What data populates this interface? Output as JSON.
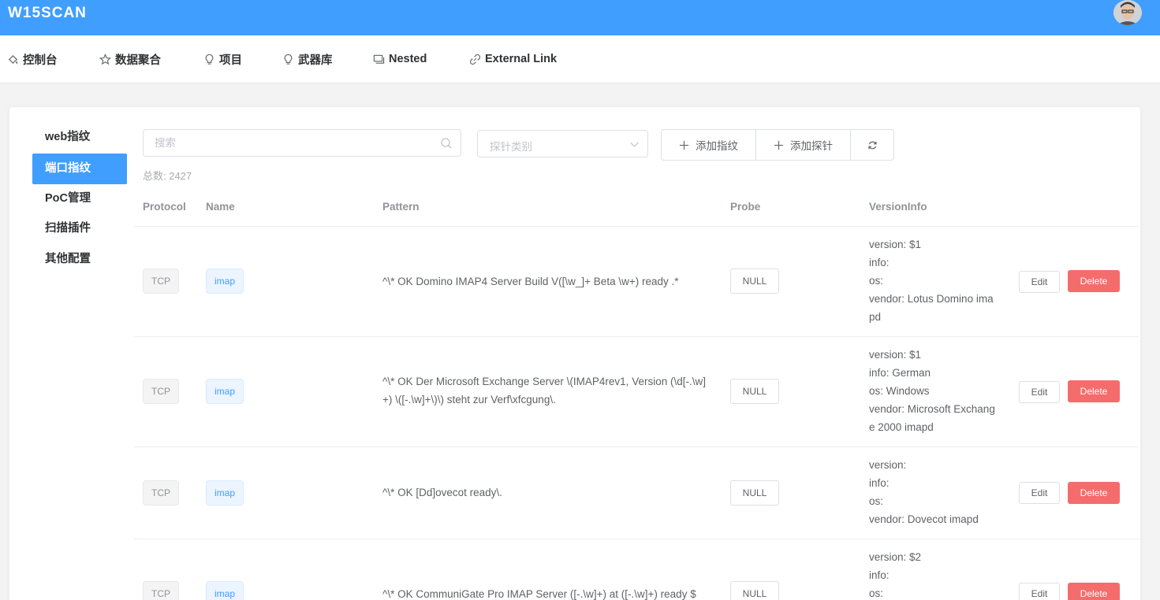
{
  "app": {
    "title": "W15SCAN"
  },
  "nav": [
    {
      "label": "控制台",
      "icon": "paint-bucket-icon"
    },
    {
      "label": "数据聚合",
      "icon": "star-icon"
    },
    {
      "label": "项目",
      "icon": "lightbulb-icon"
    },
    {
      "label": "武器库",
      "icon": "lightbulb-icon"
    },
    {
      "label": "Nested",
      "icon": "window-icon"
    },
    {
      "label": "External Link",
      "icon": "link-icon"
    }
  ],
  "sidebar": {
    "items": [
      {
        "label": "web指纹",
        "active": false
      },
      {
        "label": "端口指纹",
        "active": true
      },
      {
        "label": "PoC管理",
        "active": false
      },
      {
        "label": "扫描插件",
        "active": false
      },
      {
        "label": "其他配置",
        "active": false
      }
    ]
  },
  "toolbar": {
    "search_placeholder": "搜索",
    "probe_select_placeholder": "探针类别",
    "add_fingerprint_label": "添加指纹",
    "add_probe_label": "添加探针"
  },
  "total_label": "总数: 2427",
  "table": {
    "headers": {
      "protocol": "Protocol",
      "name": "Name",
      "pattern": "Pattern",
      "probe": "Probe",
      "versioninfo": "VersionInfo"
    },
    "rows": [
      {
        "protocol": "TCP",
        "name": "imap",
        "pattern": "^\\* OK Domino IMAP4 Server Build V([\\w_]+ Beta \\w+) ready .*",
        "probe": "NULL",
        "version": "version: $1",
        "info": "info:",
        "os": "os:",
        "vendor": "vendor: Lotus Domino imapd",
        "edit": "Edit",
        "delete": "Delete"
      },
      {
        "protocol": "TCP",
        "name": "imap",
        "pattern": "^\\* OK Der Microsoft Exchange Server \\(IMAP4rev1, Version (\\d[-.\\w]+) \\([-.\\w]+\\)\\) steht zur Verf\\xfcgung\\.",
        "probe": "NULL",
        "version": "version: $1",
        "info": "info: German",
        "os": "os: Windows",
        "vendor": "vendor: Microsoft Exchange 2000 imapd",
        "edit": "Edit",
        "delete": "Delete"
      },
      {
        "protocol": "TCP",
        "name": "imap",
        "pattern": "^\\* OK [Dd]ovecot ready\\.",
        "probe": "NULL",
        "version": "version:",
        "info": "info:",
        "os": "os:",
        "vendor": "vendor: Dovecot imapd",
        "edit": "Edit",
        "delete": "Delete"
      },
      {
        "protocol": "TCP",
        "name": "imap",
        "pattern": "^\\* OK CommuniGate Pro IMAP Server ([-.\\w]+) at ([-.\\w]+) ready $",
        "probe": "NULL",
        "version": "version: $2",
        "info": "info:",
        "os": "os:",
        "vendor": "",
        "edit": "Edit",
        "delete": "Delete"
      }
    ]
  }
}
